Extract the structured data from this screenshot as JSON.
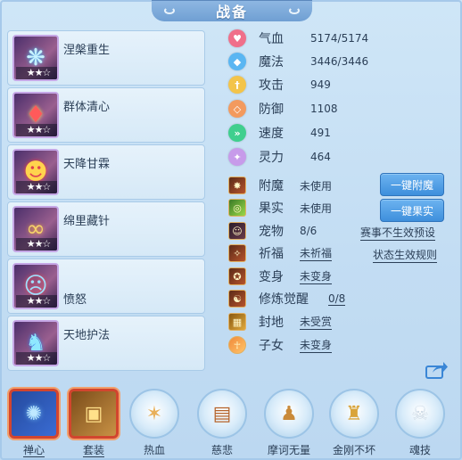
{
  "window": {
    "title": "战备"
  },
  "skills": [
    {
      "name": "涅槃重生",
      "stars": "★★☆",
      "icon": "phoenix-fan-icon"
    },
    {
      "name": "群体清心",
      "stars": "★★☆",
      "icon": "red-gem-icon"
    },
    {
      "name": "天降甘霖",
      "stars": "★★☆",
      "icon": "demon-mask-icon"
    },
    {
      "name": "绵里藏针",
      "stars": "★★☆",
      "icon": "golden-chain-icon"
    },
    {
      "name": "愤怒",
      "stars": "★★☆",
      "icon": "angry-face-icon"
    },
    {
      "name": "天地护法",
      "stars": "★★☆",
      "icon": "warrior-icon"
    }
  ],
  "stats": [
    {
      "label": "气血",
      "value": "5174/5174",
      "icon": "heart-icon",
      "color": "#f06f8a",
      "glyph": "♥"
    },
    {
      "label": "魔法",
      "value": "3446/3446",
      "icon": "diamond-icon",
      "color": "#5ab6f2",
      "glyph": "◆"
    },
    {
      "label": "攻击",
      "value": "949",
      "icon": "sword-icon",
      "color": "#f3c44a",
      "glyph": "†"
    },
    {
      "label": "防御",
      "value": "1108",
      "icon": "shield-icon",
      "color": "#f39a5e",
      "glyph": "◇"
    },
    {
      "label": "速度",
      "value": "491",
      "icon": "speed-icon",
      "color": "#3fcf8e",
      "glyph": "»"
    },
    {
      "label": "灵力",
      "value": "464",
      "icon": "spirit-icon",
      "color": "#c79bea",
      "glyph": "✦"
    }
  ],
  "equips": [
    {
      "label": "附魔",
      "value": "未使用",
      "icon": "enchant-icon",
      "link": false
    },
    {
      "label": "果实",
      "value": "未使用",
      "icon": "fruit-icon",
      "link": false
    },
    {
      "label": "宠物",
      "value": "8/6",
      "icon": "pet-icon",
      "link": false
    },
    {
      "label": "祈福",
      "value": "未祈福",
      "icon": "bless-icon",
      "link": true
    },
    {
      "label": "变身",
      "value": "未变身",
      "icon": "transform-icon",
      "link": true
    },
    {
      "label": "修炼觉醒",
      "value": "0/8",
      "icon": "cultivate-icon",
      "link": true
    },
    {
      "label": "封地",
      "value": "未受赏",
      "icon": "fief-icon",
      "link": true
    },
    {
      "label": "子女",
      "value": "未变身",
      "icon": "children-icon",
      "link": true
    }
  ],
  "buttons": {
    "enchant": "一键附魔",
    "fruit": "一键果实"
  },
  "links": {
    "event_preset": "赛事不生效预设",
    "status_rules": "状态生效规则"
  },
  "bottom": [
    {
      "label": "禅心",
      "icon": "zen-heart-icon",
      "glyph": "✺"
    },
    {
      "label": "套装",
      "icon": "armor-set-icon",
      "glyph": "▣"
    },
    {
      "label": "热血",
      "icon": "hot-blood-icon",
      "glyph": "✶"
    },
    {
      "label": "慈悲",
      "icon": "mercy-icon",
      "glyph": "▤"
    },
    {
      "label": "摩诃无量",
      "icon": "mahe-icon",
      "glyph": "♟"
    },
    {
      "label": "金刚不坏",
      "icon": "vajra-icon",
      "glyph": "♜"
    },
    {
      "label": "魂技",
      "icon": "soul-skill-icon",
      "glyph": "☠"
    }
  ]
}
